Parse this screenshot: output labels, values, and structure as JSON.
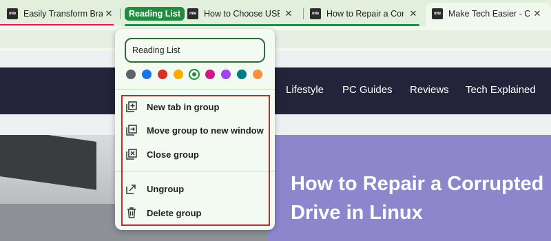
{
  "tabs": [
    {
      "title": "Easily Transform Brav",
      "favicon": "mte",
      "close": "✕"
    },
    {
      "title": "How to Choose USB-",
      "favicon": "mte",
      "close": "✕"
    },
    {
      "title": "How to Repair a Corr",
      "favicon": "mte",
      "close": "✕"
    },
    {
      "title": "Make Tech Easier - Co",
      "favicon": "mte",
      "close": "✕"
    }
  ],
  "tab_group": {
    "name": "Reading List",
    "color": "#1e8e3e"
  },
  "popup": {
    "name_value": "Reading List",
    "colors": [
      "#5f6368",
      "#1a73e8",
      "#d93025",
      "#f9ab00",
      "#1e8e3e",
      "#d01884",
      "#a142f4",
      "#007b83",
      "#fa903e"
    ],
    "selected_color": "#1e8e3e",
    "menu": [
      {
        "label": "New tab in group",
        "icon": "new-tab-icon"
      },
      {
        "label": "Move group to new window",
        "icon": "move-window-icon"
      },
      {
        "label": "Close group",
        "icon": "close-group-icon"
      },
      {
        "label": "Ungroup",
        "icon": "ungroup-icon"
      },
      {
        "label": "Delete group",
        "icon": "trash-icon"
      }
    ]
  },
  "site": {
    "nav": [
      "Lifestyle",
      "PC Guides",
      "Reviews",
      "Tech Explained"
    ],
    "hero_title": "How to Repair a Corrupted Drive in Linux"
  },
  "annotation_color": "#c62828"
}
